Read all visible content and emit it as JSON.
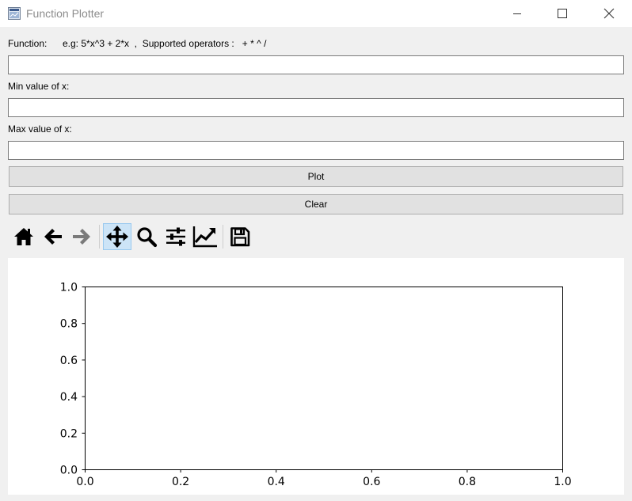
{
  "window": {
    "title": "Function Plotter",
    "icon": "app-window-icon",
    "controls": [
      "minimize-icon",
      "maximize-icon",
      "close-icon"
    ]
  },
  "form": {
    "function_label": "Function:",
    "function_hint": "e.g: 5*x^3 + 2*x  ,  Supported operators :   + * ^ /",
    "function_value": "",
    "min_label": "Min value of x:",
    "min_value": "",
    "max_label": "Max value of x:",
    "max_value": ""
  },
  "buttons": {
    "plot": "Plot",
    "clear": "Clear"
  },
  "toolbar": {
    "tools": [
      {
        "name": "home",
        "icon": "home-icon",
        "enabled": true
      },
      {
        "name": "back",
        "icon": "arrow-left-icon",
        "enabled": true
      },
      {
        "name": "forward",
        "icon": "arrow-right-icon",
        "enabled": false
      },
      {
        "name": "pan",
        "icon": "move-icon",
        "enabled": true,
        "active": true
      },
      {
        "name": "zoom",
        "icon": "magnifier-icon",
        "enabled": true
      },
      {
        "name": "configure-subplots",
        "icon": "sliders-icon",
        "enabled": true
      },
      {
        "name": "edit-axis",
        "icon": "line-chart-icon",
        "enabled": true
      },
      {
        "name": "save",
        "icon": "floppy-disk-icon",
        "enabled": true
      }
    ]
  },
  "chart_data": {
    "type": "line",
    "series": [],
    "xlim": [
      0.0,
      1.0
    ],
    "ylim": [
      0.0,
      1.0
    ],
    "xticks": [
      "0.0",
      "0.2",
      "0.4",
      "0.6",
      "0.8",
      "1.0"
    ],
    "yticks": [
      "0.0",
      "0.2",
      "0.4",
      "0.6",
      "0.8",
      "1.0"
    ],
    "grid": false
  }
}
